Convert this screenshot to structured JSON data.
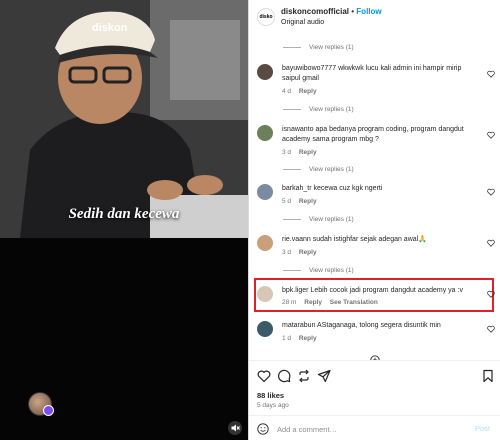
{
  "video": {
    "caption": "Sedih dan kecewa",
    "brand_text": "diskon"
  },
  "header": {
    "avatar_text": "disko",
    "username": "diskoncomofficial",
    "separator": "•",
    "follow_label": "Follow",
    "audio": "Original audio"
  },
  "comments": [
    {
      "view_replies": "View replies (1)"
    },
    {
      "username": "bayuwibowo7777",
      "text": "wkwkwk lucu kali admin ini hampir mirip saipul gmail",
      "time": "4 d",
      "reply": "Reply",
      "avatar_color": "#5a4a44"
    },
    {
      "view_replies": "View replies (1)"
    },
    {
      "username": "isnawanto",
      "text": "apa bedanya program coding, program dangdut academy sama program mbg ?",
      "time": "3 d",
      "reply": "Reply",
      "avatar_color": "#6b7f5a"
    },
    {
      "view_replies": "View replies (1)"
    },
    {
      "username": "barkah_tr",
      "text": "kecewa cuz kgk ngerti",
      "time": "5 d",
      "reply": "Reply",
      "avatar_color": "#7a8aa0"
    },
    {
      "view_replies": "View replies (1)"
    },
    {
      "username": "rie.vaann",
      "text": "sudah istighfar sejak adegan awal🙏",
      "time": "3 d",
      "reply": "Reply",
      "avatar_color": "#c9a07a"
    },
    {
      "view_replies": "View replies (1)"
    },
    {
      "username": "bpk.liger",
      "text": "Lebih cocok jadi program dangdut academy ya :v",
      "time": "28 m",
      "reply": "Reply",
      "translate": "See Translation",
      "avatar_color": "#d8c7b5"
    },
    {
      "username": "matarabun",
      "text": "AStaganaga, tolong segera disuntik min",
      "time": "1 d",
      "reply": "Reply",
      "avatar_color": "#3d5a6b"
    }
  ],
  "footer": {
    "likes": "88 likes",
    "date": "5 days ago",
    "comment_placeholder": "Add a comment…",
    "post_label": "Post"
  },
  "colors": {
    "follow": "#0095f6",
    "highlight": "#e0212b",
    "muted_text": "#737373"
  },
  "icons": [
    "heart-icon",
    "comment-icon",
    "repost-icon",
    "share-icon",
    "bookmark-icon",
    "emoji-icon",
    "mute-icon",
    "load-more-icon"
  ]
}
